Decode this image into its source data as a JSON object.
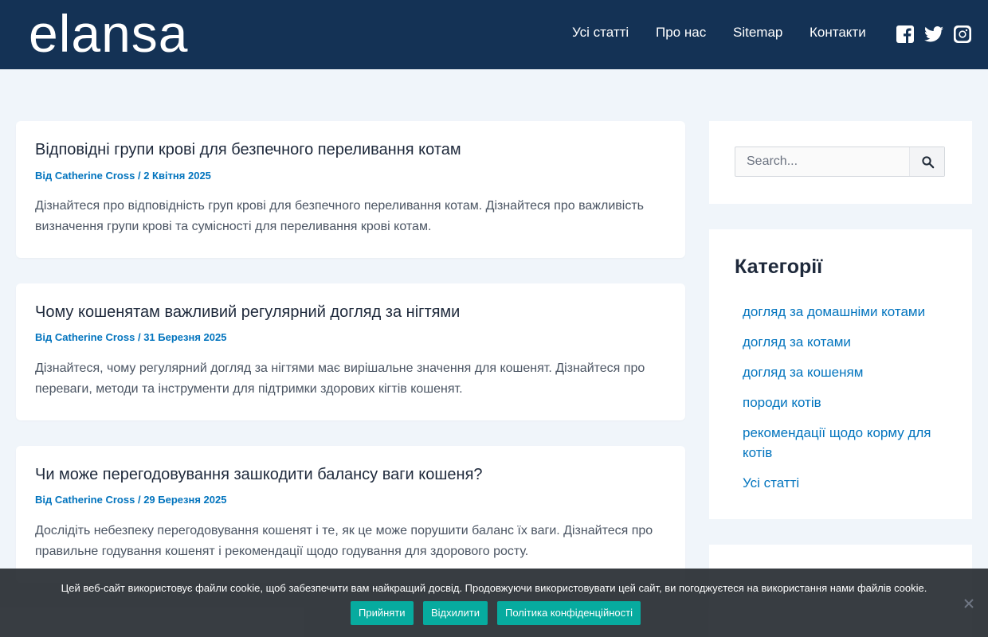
{
  "header": {
    "logo": "elansa",
    "nav": [
      "Усі статті",
      "Про нас",
      "Sitemap",
      "Контакти"
    ],
    "social_icons": [
      "facebook-icon",
      "twitter-icon",
      "instagram-icon"
    ]
  },
  "posts": [
    {
      "title": "Відповідні групи крові для безпечного переливання котам",
      "author_prefix": "Від",
      "author": "Catherine Cross",
      "separator": "/",
      "date": "2 Квітня 2025",
      "excerpt": "Дізнайтеся про відповідність груп крові для безпечного переливання котам. Дізнайтеся про важливість визначення групи крові та сумісності для переливання крові котам."
    },
    {
      "title": "Чому кошенятам важливий регулярний догляд за нігтями",
      "author_prefix": "Від",
      "author": "Catherine Cross",
      "separator": "/",
      "date": "31 Березня 2025",
      "excerpt": "Дізнайтеся, чому регулярний догляд за нігтями має вирішальне значення для кошенят. Дізнайтеся про переваги, методи та інструменти для підтримки здорових кігтів кошенят."
    },
    {
      "title": "Чи може перегодовування зашкодити балансу ваги кошеня?",
      "author_prefix": "Від",
      "author": "Catherine Cross",
      "separator": "/",
      "date": "29 Березня 2025",
      "excerpt": "Дослідіть небезпеку перегодовування кошенят і те, як це може порушити баланс їх ваги. Дізнайтеся про правильне годування кошенят і рекомендації щодо годування для здорового росту."
    }
  ],
  "sidebar": {
    "search_placeholder": "Search...",
    "categories_title": "Категорії",
    "categories": [
      "догляд за домашніми котами",
      "догляд за котами",
      "догляд за кошеням",
      "породи котів",
      "рекомендації щодо корму для котів",
      "Усі статті"
    ]
  },
  "cookie": {
    "text": "Цей веб-сайт використовує файли cookie, щоб забезпечити вам найкращий досвід. Продовжуючи використовувати цей сайт, ви погоджуєтеся на використання нами файлів cookie.",
    "accept": "Прийняти",
    "decline": "Відхилити",
    "policy": "Політика конфіденційності"
  },
  "colors": {
    "header_bg": "#143255",
    "page_bg": "#f0f5fa",
    "link": "#0274be",
    "cookie_bg": "#32373c",
    "cookie_button": "#00a99d"
  }
}
